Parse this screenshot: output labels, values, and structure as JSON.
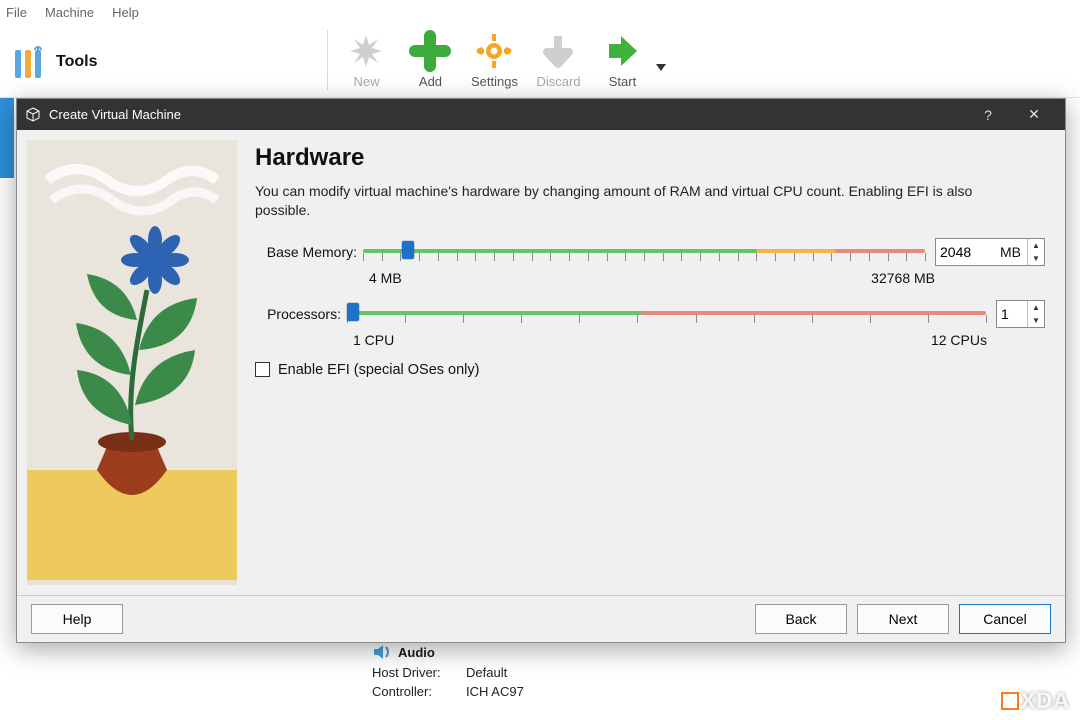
{
  "menu": {
    "file": "File",
    "machine": "Machine",
    "help": "Help"
  },
  "toolbar": {
    "tools_label": "Tools",
    "new": "New",
    "add": "Add",
    "settings": "Settings",
    "discard": "Discard",
    "start": "Start"
  },
  "dialog": {
    "title": "Create Virtual Machine",
    "page_heading": "Hardware",
    "description": "You can modify virtual machine's hardware by changing amount of RAM and virtual CPU count. Enabling EFI is also possible.",
    "memory": {
      "label": "Base Memory:",
      "min_label": "4 MB",
      "max_label": "32768 MB",
      "value": "2048",
      "suffix": "MB",
      "thumb_pct": 8
    },
    "cpu": {
      "label": "Processors:",
      "min_label": "1 CPU",
      "max_label": "12 CPUs",
      "value": "1",
      "thumb_pct": 1
    },
    "efi_label": "Enable EFI (special OSes only)",
    "buttons": {
      "help": "Help",
      "back": "Back",
      "next": "Next",
      "cancel": "Cancel"
    }
  },
  "bg_panel": {
    "section": "Audio",
    "rows": [
      {
        "k": "Host Driver:",
        "v": "Default"
      },
      {
        "k": "Controller:",
        "v": "ICH AC97"
      }
    ]
  },
  "watermark": "XDA"
}
